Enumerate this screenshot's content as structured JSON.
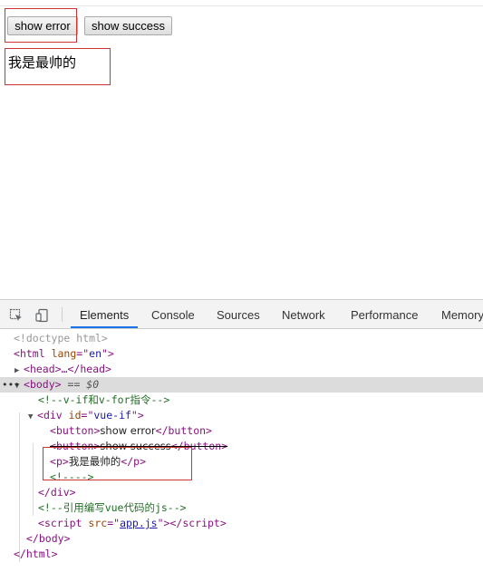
{
  "page": {
    "buttons": [
      {
        "label": "show error"
      },
      {
        "label": "show success"
      }
    ],
    "paragraph": "我是最帅的"
  },
  "devtools": {
    "tabs": [
      "Elements",
      "Console",
      "Sources",
      "Network",
      "Performance",
      "Memory"
    ],
    "active_tab": "Elements",
    "tree": {
      "doctype": "<!doctype html>",
      "html_tag": "html",
      "html_attr": "lang",
      "html_val": "en",
      "head": "head",
      "body_tag": "body",
      "selected_marker": "== $0",
      "comment_vif": "<!--v-if和v-for指令-->",
      "div_tag": "div",
      "div_attr": "id",
      "div_val": "vue-if",
      "button_tag": "button",
      "button1_text": "show error",
      "button2_text": "show success",
      "p_tag": "p",
      "p_text": "我是最帅的",
      "empty_comment": "<!---->",
      "comment_js": "<!--引用编写vue代码的js-->",
      "script_tag": "script",
      "script_attr": "src",
      "script_src": "app.js"
    },
    "colors": {
      "highlight_border": "#cc3333",
      "active_tab_underline": "#1a73e8",
      "tag": "#881280",
      "attr": "#994500",
      "value": "#1a1aa6",
      "comment": "#236e25"
    }
  }
}
